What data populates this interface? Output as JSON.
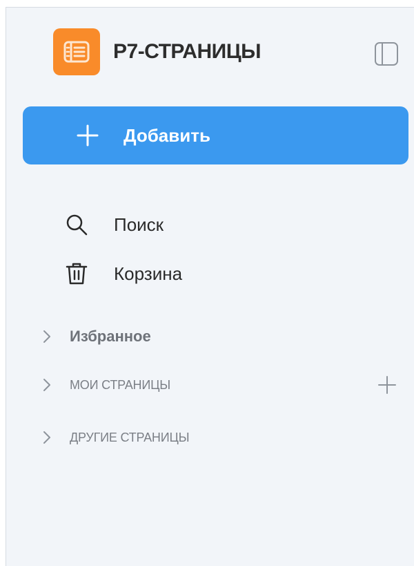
{
  "app": {
    "title": "Р7-СТРАНИЦЫ",
    "logo_icon": "document-book-icon",
    "logo_color": "#f98b2a"
  },
  "header": {
    "panel_toggle_icon": "sidebar-panel-icon"
  },
  "add_button": {
    "label": "Добавить",
    "icon": "plus-icon",
    "color": "#3b99ef"
  },
  "nav": [
    {
      "label": "Поиск",
      "icon": "search-icon"
    },
    {
      "label": "Корзина",
      "icon": "trash-icon"
    }
  ],
  "sections": {
    "favorites": {
      "label": "Избранное",
      "icon": "chevron-right-icon",
      "expanded": false
    },
    "my_pages": {
      "label": "МОИ СТРАНИЦЫ",
      "icon": "chevron-right-icon",
      "expanded": false,
      "add_icon": "plus-icon"
    },
    "other_pages": {
      "label": "ДРУГИЕ СТРАНИЦЫ",
      "icon": "chevron-right-icon",
      "expanded": false
    }
  },
  "colors": {
    "sidebar_background": "#f2f5f9",
    "text_primary": "#2a2a2a",
    "text_muted": "#7b7f86"
  }
}
